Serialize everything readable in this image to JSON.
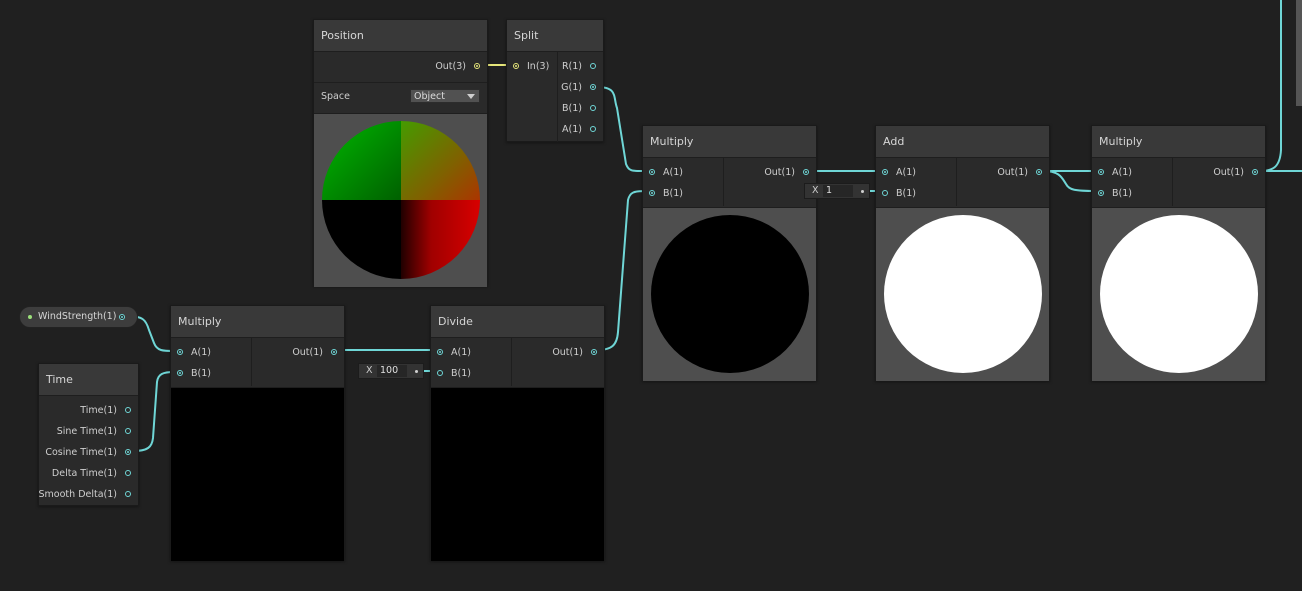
{
  "nodes": {
    "position": {
      "title": "Position",
      "out": "Out(3)",
      "space_label": "Space",
      "space_value": "Object"
    },
    "split": {
      "title": "Split",
      "in": "In(3)",
      "outs": [
        "R(1)",
        "G(1)",
        "B(1)",
        "A(1)"
      ]
    },
    "wind": {
      "label": "WindStrength(1)"
    },
    "time": {
      "title": "Time",
      "outs": [
        "Time(1)",
        "Sine Time(1)",
        "Cosine Time(1)",
        "Delta Time(1)",
        "Smooth Delta(1)"
      ]
    },
    "multiply1": {
      "title": "Multiply",
      "a": "A(1)",
      "b": "B(1)",
      "out": "Out(1)"
    },
    "divide": {
      "title": "Divide",
      "a": "A(1)",
      "b": "B(1)",
      "out": "Out(1)",
      "b_field_label": "X",
      "b_field_value": "100"
    },
    "multiply2": {
      "title": "Multiply",
      "a": "A(1)",
      "b": "B(1)",
      "out": "Out(1)"
    },
    "add": {
      "title": "Add",
      "a": "A(1)",
      "b": "B(1)",
      "out": "Out(1)",
      "b_field_label": "X",
      "b_field_value": "1"
    },
    "multiply3": {
      "title": "Multiply",
      "a": "A(1)",
      "b": "B(1)",
      "out": "Out(1)"
    }
  },
  "colors": {
    "canvas": "#202020",
    "node_body": "#2a2a2a",
    "node_header": "#393939",
    "wire_float": "#6fd6d6",
    "wire_vector3": "#e6e67a"
  }
}
